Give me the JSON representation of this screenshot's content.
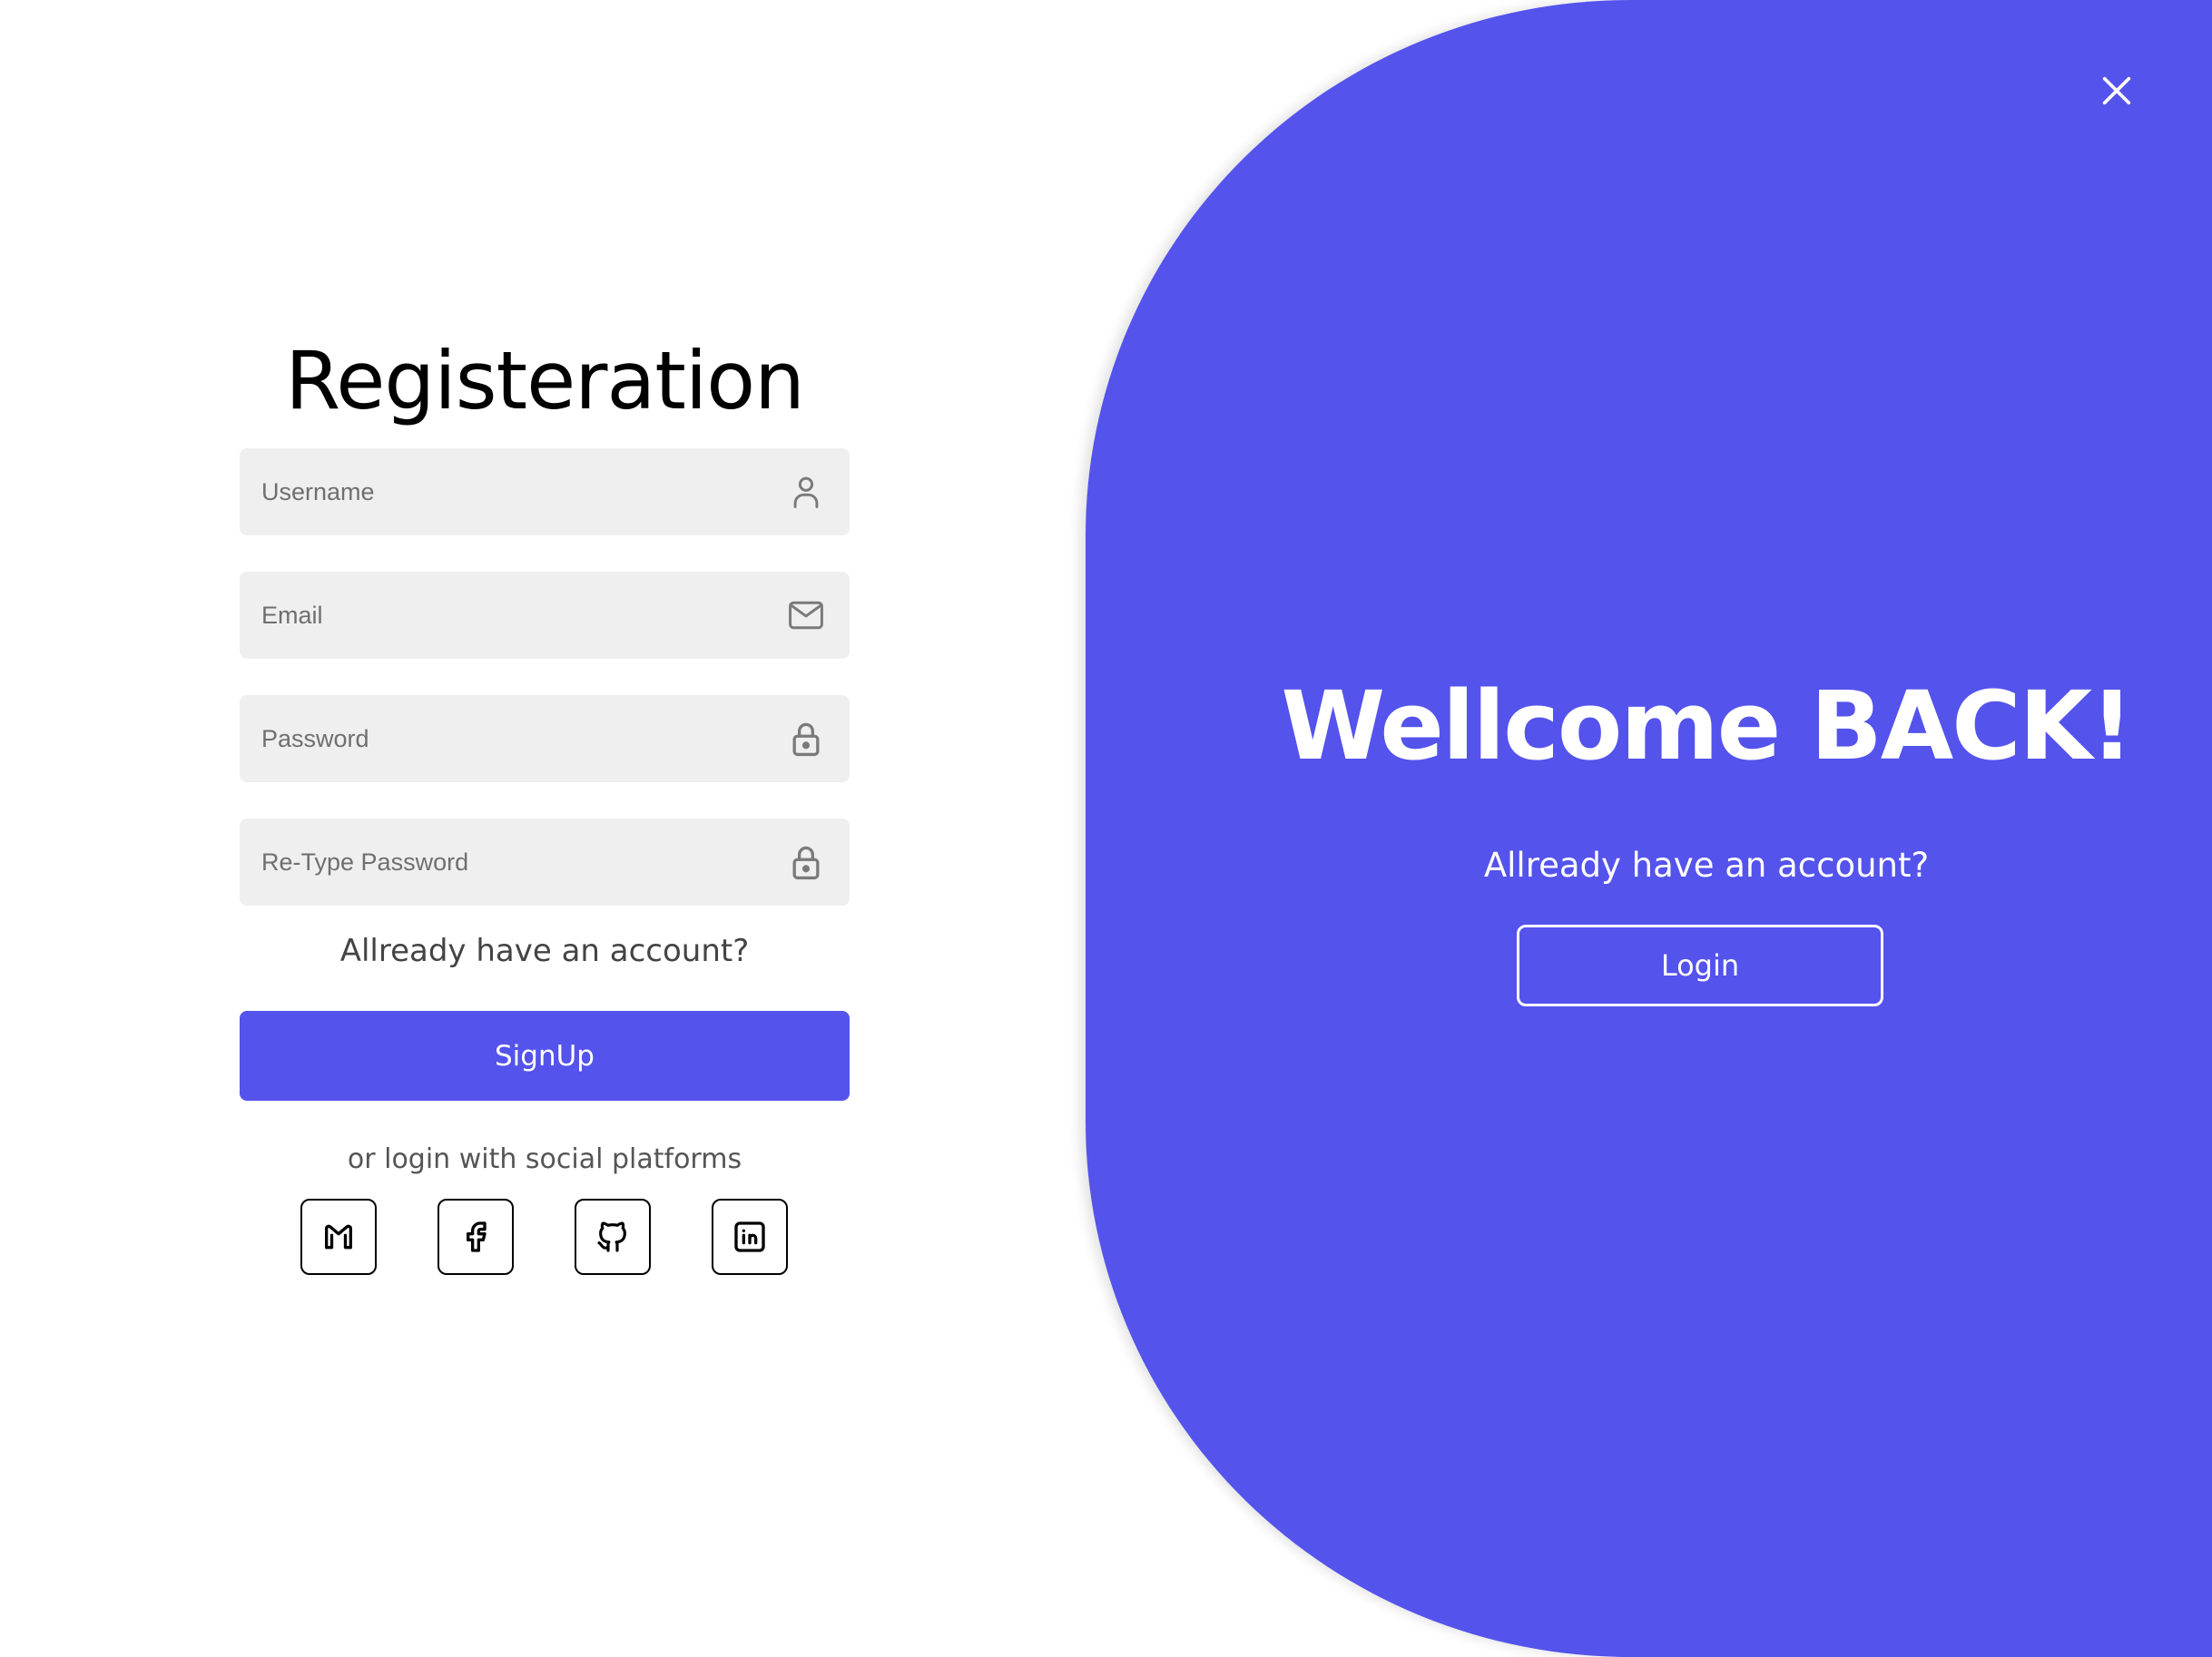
{
  "registration": {
    "title": "Registeration",
    "fields": {
      "username": {
        "placeholder": "Username",
        "value": "",
        "icon": "user-icon"
      },
      "email": {
        "placeholder": "Email",
        "value": "",
        "icon": "envelope-icon"
      },
      "password": {
        "placeholder": "Password",
        "value": "",
        "icon": "lock-icon"
      },
      "retype_password": {
        "placeholder": "Re-Type Password",
        "value": "",
        "icon": "lock-icon"
      }
    },
    "already_account": "Allready have an account?",
    "signup_label": "SignUp",
    "social_text": "or login with social platforms",
    "social": [
      {
        "name": "gmail",
        "icon": "gmail-icon"
      },
      {
        "name": "facebook",
        "icon": "facebook-icon"
      },
      {
        "name": "github",
        "icon": "github-icon"
      },
      {
        "name": "linkedin",
        "icon": "linkedin-icon"
      }
    ]
  },
  "welcome": {
    "title": "Wellcome BACK!",
    "subtitle": "Allready have an account?",
    "login_label": "Login",
    "close_icon": "close-icon"
  },
  "colors": {
    "accent": "#5453ec",
    "field_background": "#efefef",
    "page_background": "#ffffff",
    "text_on_accent": "#ffffff"
  }
}
